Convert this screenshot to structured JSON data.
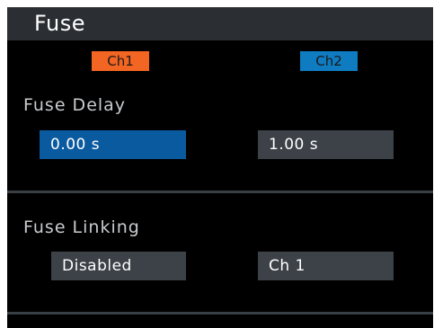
{
  "window": {
    "title": "Fuse"
  },
  "channels": {
    "ch1_label": "Ch1",
    "ch2_label": "Ch2",
    "ch1_color": "#f26522",
    "ch2_color": "#0f7bc1"
  },
  "fuse_delay": {
    "label": "Fuse Delay",
    "ch1_value": "0.00 s",
    "ch2_value": "1.00 s"
  },
  "fuse_linking": {
    "label": "Fuse Linking",
    "ch1_value": "Disabled",
    "ch2_value": "Ch 1"
  }
}
